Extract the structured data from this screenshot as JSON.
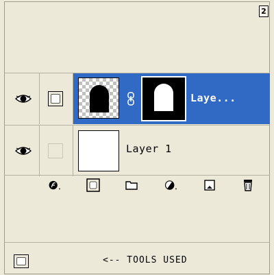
{
  "panel": {
    "corner_glyph": "2",
    "layers": [
      {
        "name": "Laye...",
        "selected": true,
        "visible": true,
        "has_mask": true
      },
      {
        "name": "Layer 1",
        "selected": false,
        "visible": true,
        "has_mask": false
      }
    ],
    "toolbar": [
      {
        "icon": "layer-style-icon"
      },
      {
        "icon": "add-mask-icon"
      },
      {
        "icon": "new-group-icon"
      },
      {
        "icon": "adjustment-layer-icon"
      },
      {
        "icon": "new-layer-icon"
      },
      {
        "icon": "trash-icon"
      }
    ]
  },
  "status": {
    "text": "<-- TOOLS USED",
    "icon": "add-mask-icon"
  },
  "colors": {
    "background": "#ece9d8",
    "selection": "#316ac5"
  }
}
